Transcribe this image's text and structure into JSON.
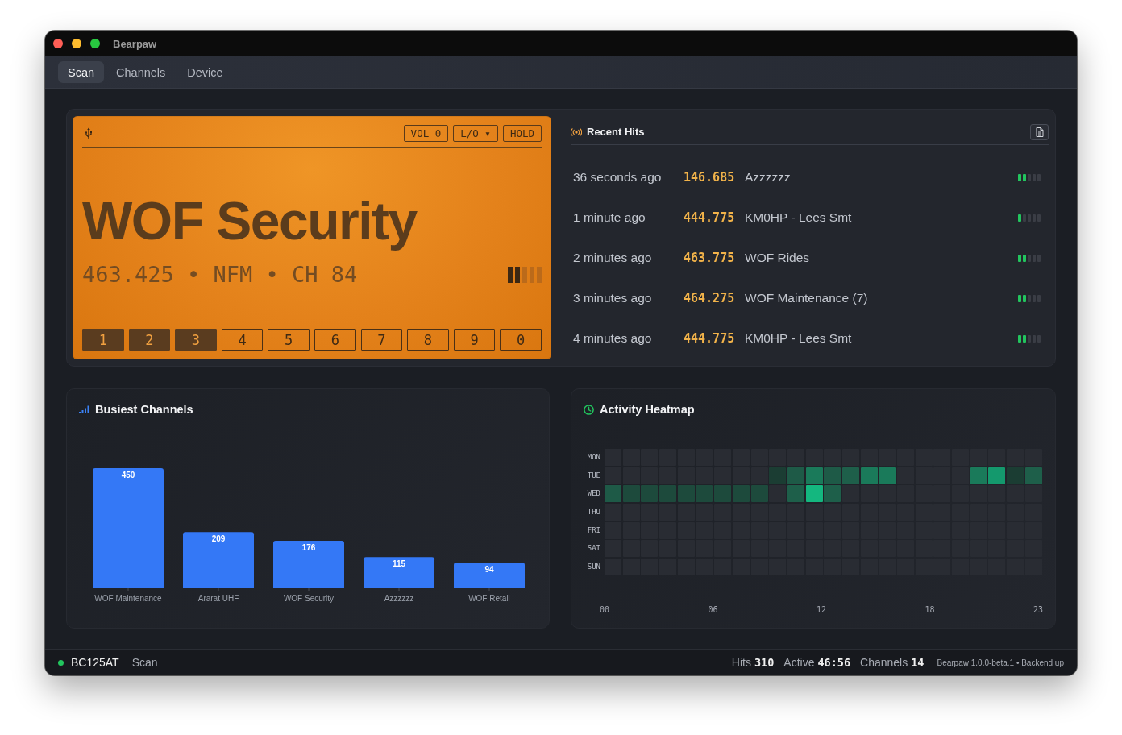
{
  "window": {
    "title": "Bearpaw"
  },
  "tabs": [
    {
      "label": "Scan",
      "selected": true
    },
    {
      "label": "Channels",
      "selected": false
    },
    {
      "label": "Device",
      "selected": false
    }
  ],
  "lcd": {
    "controls": [
      {
        "label": "VOL 0"
      },
      {
        "label": "L/O ▾"
      },
      {
        "label": "HOLD"
      }
    ],
    "channel_name": "WOF Security",
    "line": "463.425 • NFM • CH 84",
    "level": 0.4,
    "banks": [
      {
        "label": "1",
        "on": true
      },
      {
        "label": "2",
        "on": true
      },
      {
        "label": "3",
        "on": true
      },
      {
        "label": "4",
        "on": false
      },
      {
        "label": "5",
        "on": false
      },
      {
        "label": "6",
        "on": false
      },
      {
        "label": "7",
        "on": false
      },
      {
        "label": "8",
        "on": false
      },
      {
        "label": "9",
        "on": false
      },
      {
        "label": "0",
        "on": false
      }
    ]
  },
  "recent_hits": {
    "title": "Recent Hits",
    "rows": [
      {
        "time": "36 seconds ago",
        "frequency": "146.685",
        "name": "Azzzzzz",
        "level": 0.4
      },
      {
        "time": "1 minute ago",
        "frequency": "444.775",
        "name": "KM0HP - Lees Smt",
        "level": 0.2
      },
      {
        "time": "2 minutes ago",
        "frequency": "463.775",
        "name": "WOF Rides",
        "level": 0.4
      },
      {
        "time": "3 minutes ago",
        "frequency": "464.275",
        "name": "WOF Maintenance (7)",
        "level": 0.4
      },
      {
        "time": "4 minutes ago",
        "frequency": "444.775",
        "name": "KM0HP - Lees Smt",
        "level": 0.4
      }
    ]
  },
  "busiest_channels": {
    "chart_data": {
      "type": "bar",
      "title": "Busiest Channels",
      "categories": [
        "WOF Maintenance",
        "Ararat UHF",
        "WOF Security",
        "Azzzzzz",
        "WOF Retail"
      ],
      "values": [
        450,
        209,
        176,
        115,
        94
      ],
      "data_labels": true
    }
  },
  "heatmap": {
    "title": "Activity Heatmap",
    "rows": [
      {
        "day": "MON",
        "cells": [
          {
            "color": "#292c33"
          },
          {
            "color": "#292c33"
          },
          {
            "color": "#292c33"
          },
          {
            "color": "#292c33"
          },
          {
            "color": "#292c33"
          },
          {
            "color": "#292c33"
          },
          {
            "color": "#292c33"
          },
          {
            "color": "#292c33"
          },
          {
            "color": "#292c33"
          },
          {
            "color": "#292c33"
          },
          {
            "color": "#292c33"
          },
          {
            "color": "#292c33"
          },
          {
            "color": "#292c33"
          },
          {
            "color": "#292c33"
          },
          {
            "color": "#292c33"
          },
          {
            "color": "#292c33"
          },
          {
            "color": "#292c33"
          },
          {
            "color": "#292c33"
          },
          {
            "color": "#292c33"
          },
          {
            "color": "#292c33"
          },
          {
            "color": "#292c33"
          },
          {
            "color": "#292c33"
          },
          {
            "color": "#292c33"
          },
          {
            "color": "#292c33"
          }
        ]
      },
      {
        "day": "TUE",
        "cells": [
          {
            "color": "#292c33"
          },
          {
            "color": "#292c33"
          },
          {
            "color": "#292c33"
          },
          {
            "color": "#292c33"
          },
          {
            "color": "#292c33"
          },
          {
            "color": "#292c33"
          },
          {
            "color": "#292c33"
          },
          {
            "color": "#292c33"
          },
          {
            "color": "#292c33"
          },
          {
            "color": "#1b3d33"
          },
          {
            "color": "#1e5a47"
          },
          {
            "color": "#1a7a5a"
          },
          {
            "color": "#1e5a47"
          },
          {
            "color": "#1e5f4a"
          },
          {
            "color": "#1a7a5a"
          },
          {
            "color": "#1a7a5a"
          },
          {
            "color": "#292c33"
          },
          {
            "color": "#292c33"
          },
          {
            "color": "#292c33"
          },
          {
            "color": "#292c33"
          },
          {
            "color": "#1a7a5a"
          },
          {
            "color": "#14996d"
          },
          {
            "color": "#1b3d33"
          },
          {
            "color": "#1e5f4a"
          }
        ]
      },
      {
        "day": "WED",
        "cells": [
          {
            "color": "#1e5a47"
          },
          {
            "color": "#1d4a3c"
          },
          {
            "color": "#1d4a3c"
          },
          {
            "color": "#1d4a3c"
          },
          {
            "color": "#1d4a3c"
          },
          {
            "color": "#1d4a3c"
          },
          {
            "color": "#1d4a3c"
          },
          {
            "color": "#1d4a3c"
          },
          {
            "color": "#1d4a3c"
          },
          {
            "color": "#292c33"
          },
          {
            "color": "#1e5f4a"
          },
          {
            "color": "#14b77f"
          },
          {
            "color": "#1e5f4a"
          },
          {
            "color": "#292c33"
          },
          {
            "color": "#292c33"
          },
          {
            "color": "#292c33"
          },
          {
            "color": "#292c33"
          },
          {
            "color": "#292c33"
          },
          {
            "color": "#292c33"
          },
          {
            "color": "#292c33"
          },
          {
            "color": "#292c33"
          },
          {
            "color": "#292c33"
          },
          {
            "color": "#292c33"
          },
          {
            "color": "#292c33"
          }
        ]
      },
      {
        "day": "THU",
        "cells": [
          {
            "color": "#292c33"
          },
          {
            "color": "#292c33"
          },
          {
            "color": "#292c33"
          },
          {
            "color": "#292c33"
          },
          {
            "color": "#292c33"
          },
          {
            "color": "#292c33"
          },
          {
            "color": "#292c33"
          },
          {
            "color": "#292c33"
          },
          {
            "color": "#292c33"
          },
          {
            "color": "#292c33"
          },
          {
            "color": "#292c33"
          },
          {
            "color": "#292c33"
          },
          {
            "color": "#292c33"
          },
          {
            "color": "#292c33"
          },
          {
            "color": "#292c33"
          },
          {
            "color": "#292c33"
          },
          {
            "color": "#292c33"
          },
          {
            "color": "#292c33"
          },
          {
            "color": "#292c33"
          },
          {
            "color": "#292c33"
          },
          {
            "color": "#292c33"
          },
          {
            "color": "#292c33"
          },
          {
            "color": "#292c33"
          },
          {
            "color": "#292c33"
          }
        ]
      },
      {
        "day": "FRI",
        "cells": [
          {
            "color": "#292c33"
          },
          {
            "color": "#292c33"
          },
          {
            "color": "#292c33"
          },
          {
            "color": "#292c33"
          },
          {
            "color": "#292c33"
          },
          {
            "color": "#292c33"
          },
          {
            "color": "#292c33"
          },
          {
            "color": "#292c33"
          },
          {
            "color": "#292c33"
          },
          {
            "color": "#292c33"
          },
          {
            "color": "#292c33"
          },
          {
            "color": "#292c33"
          },
          {
            "color": "#292c33"
          },
          {
            "color": "#292c33"
          },
          {
            "color": "#292c33"
          },
          {
            "color": "#292c33"
          },
          {
            "color": "#292c33"
          },
          {
            "color": "#292c33"
          },
          {
            "color": "#292c33"
          },
          {
            "color": "#292c33"
          },
          {
            "color": "#292c33"
          },
          {
            "color": "#292c33"
          },
          {
            "color": "#292c33"
          },
          {
            "color": "#292c33"
          }
        ]
      },
      {
        "day": "SAT",
        "cells": [
          {
            "color": "#292c33"
          },
          {
            "color": "#292c33"
          },
          {
            "color": "#292c33"
          },
          {
            "color": "#292c33"
          },
          {
            "color": "#292c33"
          },
          {
            "color": "#292c33"
          },
          {
            "color": "#292c33"
          },
          {
            "color": "#292c33"
          },
          {
            "color": "#292c33"
          },
          {
            "color": "#292c33"
          },
          {
            "color": "#292c33"
          },
          {
            "color": "#292c33"
          },
          {
            "color": "#292c33"
          },
          {
            "color": "#292c33"
          },
          {
            "color": "#292c33"
          },
          {
            "color": "#292c33"
          },
          {
            "color": "#292c33"
          },
          {
            "color": "#292c33"
          },
          {
            "color": "#292c33"
          },
          {
            "color": "#292c33"
          },
          {
            "color": "#292c33"
          },
          {
            "color": "#292c33"
          },
          {
            "color": "#292c33"
          },
          {
            "color": "#292c33"
          }
        ]
      },
      {
        "day": "SUN",
        "cells": [
          {
            "color": "#292c33"
          },
          {
            "color": "#292c33"
          },
          {
            "color": "#292c33"
          },
          {
            "color": "#292c33"
          },
          {
            "color": "#292c33"
          },
          {
            "color": "#292c33"
          },
          {
            "color": "#292c33"
          },
          {
            "color": "#292c33"
          },
          {
            "color": "#292c33"
          },
          {
            "color": "#292c33"
          },
          {
            "color": "#292c33"
          },
          {
            "color": "#292c33"
          },
          {
            "color": "#292c33"
          },
          {
            "color": "#292c33"
          },
          {
            "color": "#292c33"
          },
          {
            "color": "#292c33"
          },
          {
            "color": "#292c33"
          },
          {
            "color": "#292c33"
          },
          {
            "color": "#292c33"
          },
          {
            "color": "#292c33"
          },
          {
            "color": "#292c33"
          },
          {
            "color": "#292c33"
          },
          {
            "color": "#292c33"
          },
          {
            "color": "#292c33"
          }
        ]
      }
    ],
    "hour_labels": [
      "00",
      "06",
      "12",
      "18",
      "23"
    ]
  },
  "status": {
    "connected": true,
    "device": "BC125AT",
    "mode": "Scan",
    "stats": [
      {
        "label": "Hits",
        "value": "310"
      },
      {
        "label": "Active",
        "value": "46:56"
      },
      {
        "label": "Channels",
        "value": "14"
      }
    ],
    "version": "Bearpaw 1.0.0-beta.1 • Backend up"
  }
}
